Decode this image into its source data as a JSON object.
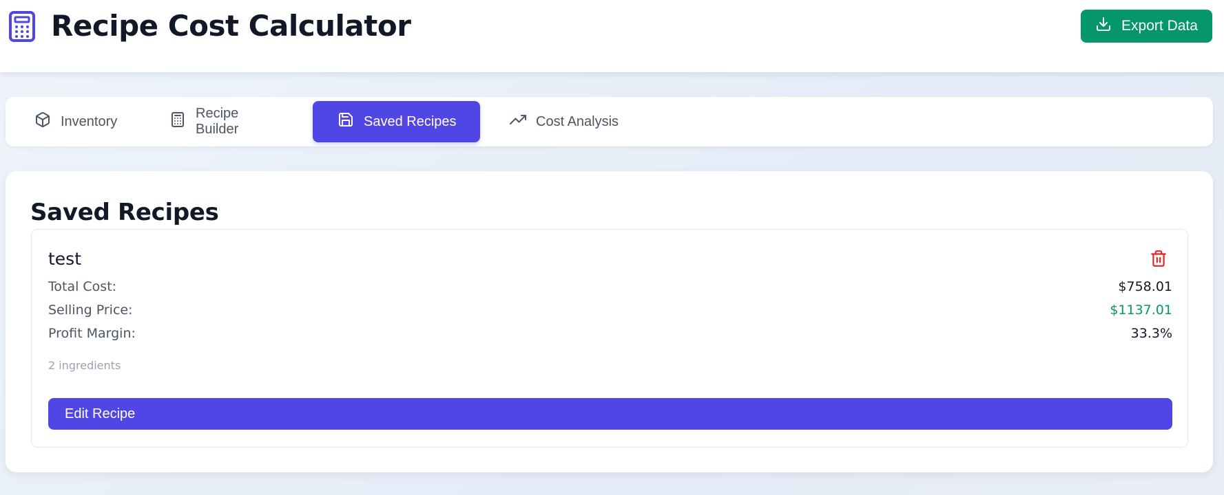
{
  "app": {
    "title": "Recipe Cost Calculator",
    "logo_icon": "calculator-icon",
    "export_label": "Export Data",
    "export_icon": "download-icon"
  },
  "tabs": [
    {
      "label": "Inventory",
      "icon": "package-icon",
      "active": false
    },
    {
      "label": "Recipe Builder",
      "icon": "calculator-icon",
      "active": false
    },
    {
      "label": "Saved Recipes",
      "icon": "save-icon",
      "active": true
    },
    {
      "label": "Cost Analysis",
      "icon": "trending-up-icon",
      "active": false
    }
  ],
  "saved_recipes": {
    "title": "Saved Recipes",
    "recipes": [
      {
        "name": "test",
        "delete_icon": "trash-icon",
        "stats": [
          {
            "label": "Total Cost:",
            "value": "$758.01"
          },
          {
            "label": "Selling Price:",
            "value": "$1137.01"
          },
          {
            "label": "Profit Margin:",
            "value": "33.3%"
          }
        ],
        "ingredient_count": "2 ingredients",
        "edit_label": "Edit Recipe"
      }
    ]
  },
  "colors": {
    "primary": "#4f46e5",
    "success": "#059669",
    "danger": "#dc2626",
    "text": "#111827",
    "muted": "#9ca3af"
  }
}
